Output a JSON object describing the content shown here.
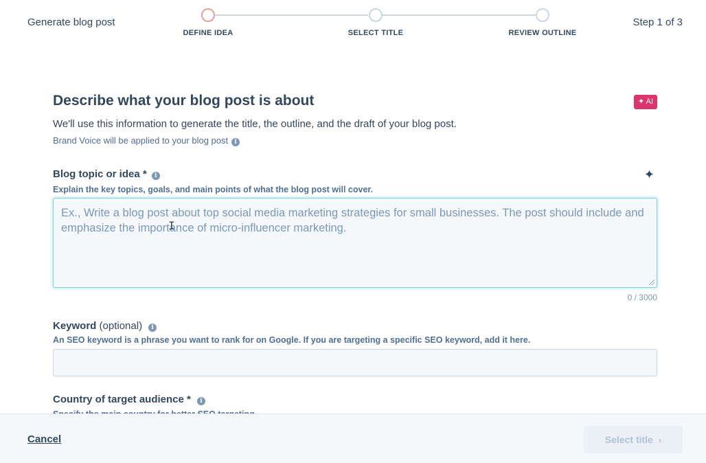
{
  "header": {
    "title": "Generate blog post",
    "step_count": "Step 1 of 3",
    "steps": [
      {
        "label": "DEFINE IDEA",
        "active": true
      },
      {
        "label": "SELECT TITLE",
        "active": false
      },
      {
        "label": "REVIEW OUTLINE",
        "active": false
      }
    ]
  },
  "section": {
    "title": "Describe what your blog post is about",
    "ai_badge": "✦ AI",
    "description": "We'll use this information to generate the title, the outline, and the draft of your blog post.",
    "brand_voice": "Brand Voice will be applied to your blog post"
  },
  "topic_field": {
    "label": "Blog topic or idea *",
    "help": "Explain the key topics, goals, and main points of what the blog post will cover.",
    "placeholder": "Ex., Write a blog post about top social media marketing strategies for small businesses. The post should include and emphasize the importance of micro-influencer marketing.",
    "value": "",
    "char_count": "0 / 3000"
  },
  "keyword_field": {
    "label": "Keyword",
    "optional": "(optional)",
    "help": "An SEO keyword is a phrase you want to rank for on Google. If you are targeting a specific SEO keyword, add it here.",
    "value": ""
  },
  "country_field": {
    "label": "Country of target audience *",
    "help": "Specify the main country for better SEO targeting."
  },
  "footer": {
    "cancel_label": "Cancel",
    "next_label": "Select title"
  },
  "icons": {
    "info": "info-icon",
    "sparkle": "sparkle-icon",
    "chevron": "chevron-right-icon"
  },
  "colors": {
    "ai_badge": "#d9376e",
    "active_step": "#e5a09a",
    "focus_border": "#7fd1de"
  }
}
